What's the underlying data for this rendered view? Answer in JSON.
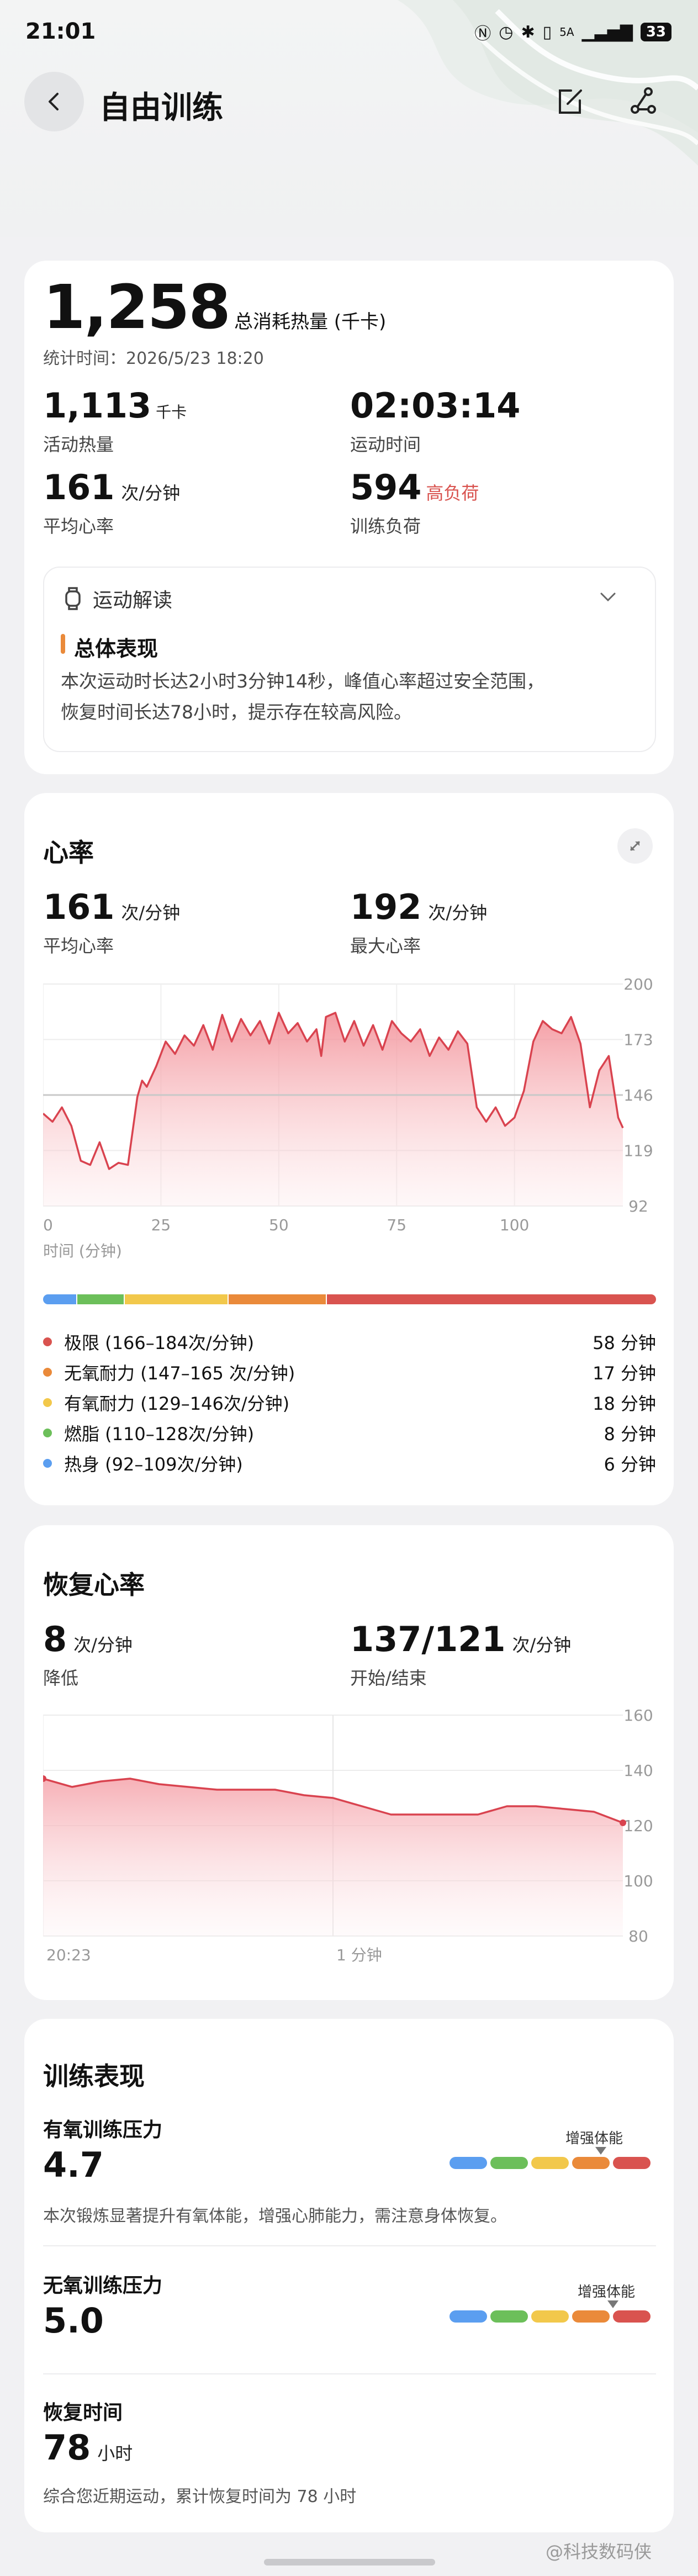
{
  "status": {
    "time": "21:01",
    "battery": "33",
    "network": "5A"
  },
  "header": {
    "title": "自由训练"
  },
  "summary": {
    "total_calories": "1,258",
    "total_label": "总消耗热量 (千卡)",
    "stat_time": "统计时间：2026/5/23 18:20",
    "active_cal": "1,113",
    "active_cal_unit": "千卡",
    "active_cal_label": "活动热量",
    "duration": "02:03:14",
    "duration_label": "运动时间",
    "avg_hr": "161",
    "avg_hr_unit": "次/分钟",
    "avg_hr_label": "平均心率",
    "load": "594",
    "load_level": "高负荷",
    "load_label": "训练负荷",
    "insight_title": "运动解读",
    "overall_title": "总体表现",
    "overall_text_1": "本次运动时长达2小时3分钟14秒，峰值心率超过安全范围，",
    "overall_text_2": "恢复时间长达78小时，提示存在较高风险。"
  },
  "heart": {
    "title": "心率",
    "avg": "161",
    "avg_unit": "次/分钟",
    "avg_label": "平均心率",
    "max": "192",
    "max_unit": "次/分钟",
    "max_label": "最大心率",
    "x_axis_label": "时间 (分钟)",
    "zones": [
      {
        "name": "极限 (166–184次/分钟)",
        "value": "58 分钟",
        "color": "#d9534f"
      },
      {
        "name": "无氧耐力 (147–165 次/分钟)",
        "value": "17 分钟",
        "color": "#ea8a3a"
      },
      {
        "name": "有氧耐力 (129–146次/分钟)",
        "value": "18 分钟",
        "color": "#f2c84b"
      },
      {
        "name": "燃脂 (110–128次/分钟)",
        "value": "8 分钟",
        "color": "#6cbf5a"
      },
      {
        "name": "热身 (92–109次/分钟)",
        "value": "6 分钟",
        "color": "#5b9ef0"
      }
    ]
  },
  "recovery": {
    "title": "恢复心率",
    "drop": "8",
    "drop_unit": "次/分钟",
    "drop_label": "降低",
    "startend": "137/121",
    "startend_unit": "次/分钟",
    "startend_label": "开始/结束"
  },
  "performance": {
    "title": "训练表现",
    "aerobic_title": "有氧训练压力",
    "aerobic_value": "4.7",
    "aerobic_tag": "增强体能",
    "aerobic_desc": "本次锻炼显著提升有氧体能，增强心肺能力，需注意身体恢复。",
    "anaerobic_title": "无氧训练压力",
    "anaerobic_value": "5.0",
    "anaerobic_tag": "增强体能",
    "recovery_title": "恢复时间",
    "recovery_value": "78",
    "recovery_unit": "小时",
    "recovery_desc": "综合您近期运动，累计恢复时间为 78 小时"
  },
  "watermark": "@科技数码侠",
  "chart_data": [
    {
      "type": "area",
      "title": "心率",
      "xlabel": "时间 (分钟)",
      "ylabel": "",
      "xlim": [
        0,
        123
      ],
      "ylim": [
        92,
        200
      ],
      "x_ticks": [
        "0",
        "25",
        "50",
        "75",
        "100"
      ],
      "y_ticks": [
        "92",
        "119",
        "146",
        "173",
        "200"
      ],
      "reference_line": 146,
      "x": [
        0,
        2,
        4,
        6,
        8,
        10,
        12,
        14,
        16,
        18,
        20,
        21,
        22,
        24,
        26,
        28,
        30,
        32,
        34,
        36,
        38,
        40,
        42,
        44,
        46,
        48,
        50,
        52,
        54,
        56,
        58,
        59,
        60,
        62,
        64,
        66,
        68,
        70,
        72,
        74,
        76,
        78,
        80,
        82,
        84,
        86,
        88,
        90,
        92,
        94,
        96,
        98,
        100,
        102,
        104,
        106,
        108,
        110,
        112,
        114,
        116,
        118,
        120,
        122,
        123
      ],
      "values": [
        137,
        133,
        140,
        131,
        114,
        112,
        123,
        110,
        113,
        112,
        145,
        153,
        150,
        160,
        172,
        166,
        175,
        170,
        180,
        168,
        185,
        172,
        183,
        175,
        182,
        171,
        186,
        176,
        181,
        172,
        178,
        165,
        184,
        186,
        172,
        182,
        170,
        180,
        168,
        182,
        176,
        172,
        178,
        165,
        174,
        168,
        177,
        171,
        140,
        133,
        140,
        131,
        135,
        148,
        172,
        182,
        178,
        176,
        184,
        171,
        140,
        158,
        165,
        135,
        130
      ]
    },
    {
      "type": "area",
      "title": "恢复心率",
      "xlabel": "",
      "ylabel": "",
      "ylim": [
        80,
        160
      ],
      "x_ticks": [
        "20:23",
        "1 分钟"
      ],
      "y_ticks": [
        "80",
        "100",
        "120",
        "140",
        "160"
      ],
      "x": [
        0,
        0.1,
        0.2,
        0.3,
        0.4,
        0.5,
        0.6,
        0.7,
        0.8,
        0.9,
        1.0,
        1.1,
        1.2,
        1.3,
        1.4,
        1.5,
        1.6,
        1.7,
        1.8,
        1.9,
        2.0
      ],
      "values": [
        137,
        134,
        136,
        137,
        135,
        134,
        133,
        133,
        133,
        131,
        130,
        127,
        124,
        124,
        124,
        124,
        127,
        127,
        126,
        125,
        121
      ]
    }
  ]
}
